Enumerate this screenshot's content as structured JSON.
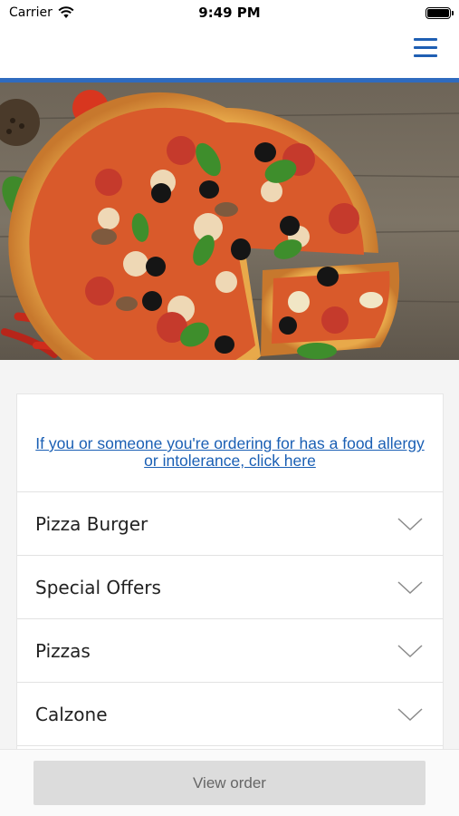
{
  "status_bar": {
    "carrier": "Carrier",
    "time": "9:49 PM"
  },
  "nav": {
    "menu_icon": "hamburger-menu-icon"
  },
  "hero": {
    "image": "pizza-hero-image"
  },
  "allergy": {
    "link_text": "If you or someone you're ordering for has a food allergy or intolerance, click here"
  },
  "categories": [
    {
      "label": "Pizza Burger"
    },
    {
      "label": "Special Offers"
    },
    {
      "label": "Pizzas"
    },
    {
      "label": "Calzone"
    }
  ],
  "footer": {
    "view_order_label": "View order"
  },
  "colors": {
    "accent": "#2f6bbf",
    "link": "#1a5fb4",
    "button_bg": "#dcdcdc"
  }
}
